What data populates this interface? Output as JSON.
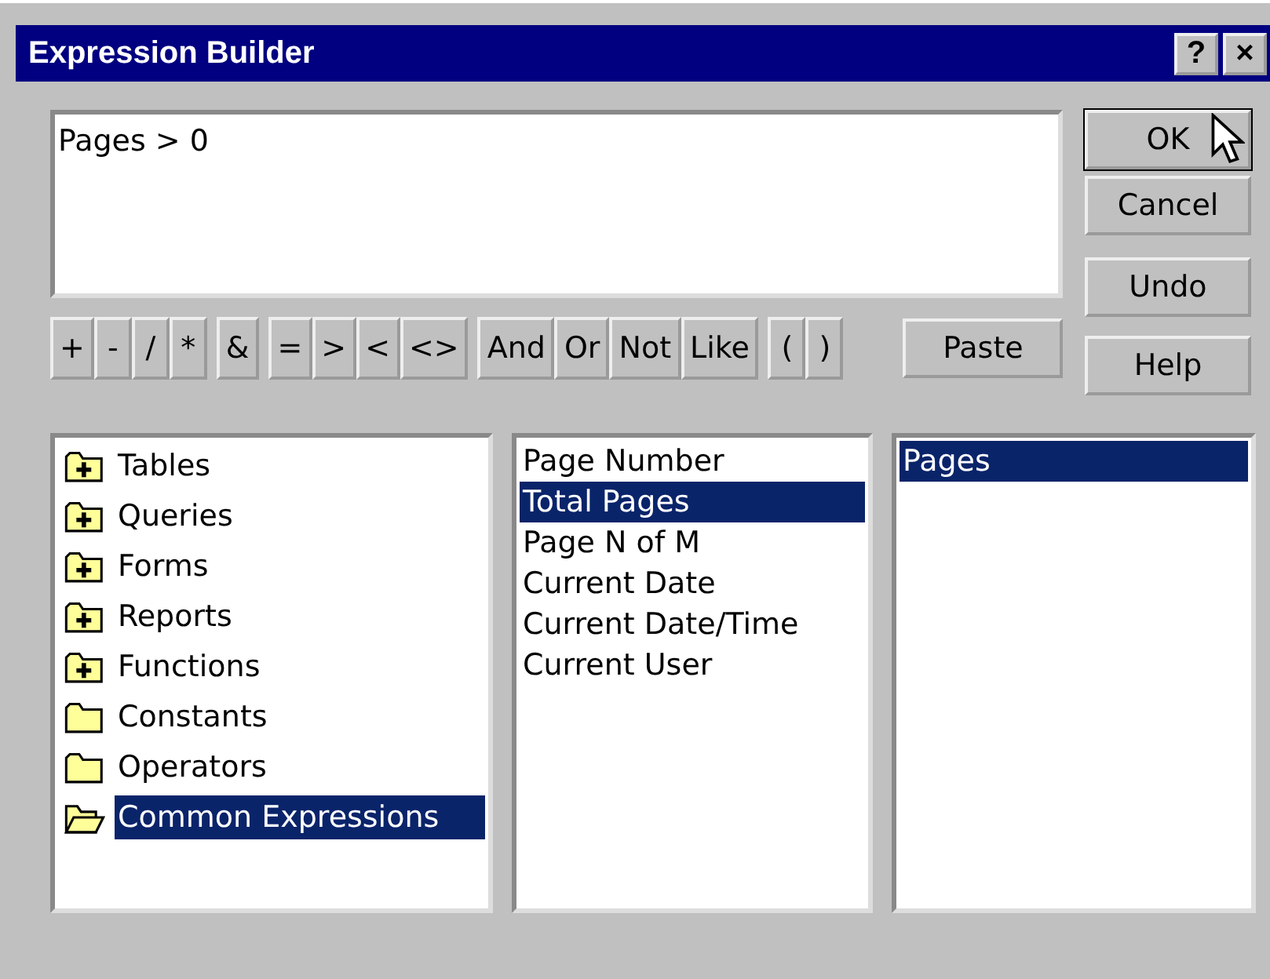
{
  "window": {
    "title": "Expression Builder",
    "title_buttons": [
      "?",
      "×"
    ]
  },
  "expression": {
    "value": "Pages > 0"
  },
  "dialog_buttons": [
    {
      "label": "OK",
      "kind": "default"
    },
    {
      "label": "Cancel",
      "kind": "normal"
    },
    {
      "label": "Undo",
      "kind": "normal"
    }
  ],
  "operator_groups": [
    [
      "+",
      "-",
      "/",
      "*"
    ],
    [
      "&"
    ],
    [
      "=",
      ">",
      "<",
      "<>"
    ],
    [
      "And",
      "Or",
      "Not",
      "Like"
    ],
    [
      "(",
      ")"
    ]
  ],
  "paste_button": "Paste",
  "help_button": "Help",
  "folders": [
    {
      "label": "Tables",
      "kind": "expandable",
      "selected": false
    },
    {
      "label": "Queries",
      "kind": "expandable",
      "selected": false
    },
    {
      "label": "Forms",
      "kind": "expandable",
      "selected": false
    },
    {
      "label": "Reports",
      "kind": "expandable",
      "selected": false
    },
    {
      "label": "Functions",
      "kind": "expandable",
      "selected": false
    },
    {
      "label": "Constants",
      "kind": "plain",
      "selected": false
    },
    {
      "label": "Operators",
      "kind": "plain",
      "selected": false
    },
    {
      "label": "Common Expressions",
      "kind": "open",
      "selected": true
    }
  ],
  "categories": [
    {
      "label": "Page Number",
      "selected": false
    },
    {
      "label": "Total Pages",
      "selected": true
    },
    {
      "label": "Page N of M",
      "selected": false
    },
    {
      "label": "Current Date",
      "selected": false
    },
    {
      "label": "Current Date/Time",
      "selected": false
    },
    {
      "label": "Current User",
      "selected": false
    }
  ],
  "values": [
    {
      "label": "Pages",
      "selected": true
    }
  ]
}
